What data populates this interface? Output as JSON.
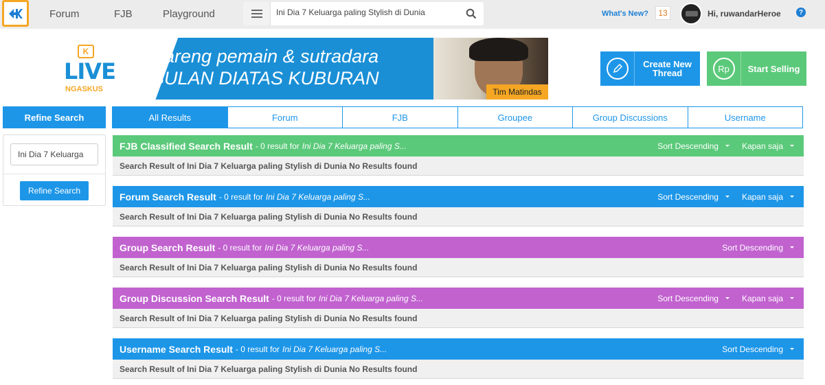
{
  "nav": {
    "links": [
      "Forum",
      "FJB",
      "Playground"
    ],
    "search_value": "Ini Dia 7 Keluarga paling Stylish di Dunia",
    "whats_new": "What's New?",
    "notification_count": "13",
    "greeting": "Hi, ruwandarHeroe",
    "help": "?"
  },
  "banner": {
    "live": "LIVE",
    "ngaskus": "NGASKUS",
    "logo_k": "K",
    "line1": "Bareng pemain & sutradara",
    "line2": "BULAN DIATAS KUBURAN",
    "person_name": "Tim Matindas"
  },
  "actions": {
    "create_thread": "Create New Thread",
    "start_selling": "Start Selling",
    "sell_icon": "Rp"
  },
  "sidebar": {
    "header": "Refine Search",
    "input_value": "Ini Dia 7 Keluarga",
    "button": "Refine Search"
  },
  "tabs": [
    "All Results",
    "Forum",
    "FJB",
    "Groupee",
    "Group Discussions",
    "Username"
  ],
  "sections": [
    {
      "title": "FJB Classified Search Result",
      "count": "- 0 result for",
      "query": "Ini Dia 7 Keluarga paling S...",
      "sort": "Sort Descending",
      "time": "Kapan saja",
      "body": "Search Result of Ini Dia 7 Keluarga paling Stylish di Dunia No Results found",
      "color": "#5bc97a"
    },
    {
      "title": "Forum Search Result",
      "count": "- 0 result for",
      "query": "Ini Dia 7 Keluarga paling S...",
      "sort": "Sort Descending",
      "time": "Kapan saja",
      "body": "Search Result of Ini Dia 7 Keluarga paling Stylish di Dunia No Results found",
      "color": "#1d96e8"
    },
    {
      "title": "Group Search Result",
      "count": "- 0 result for",
      "query": "Ini Dia 7 Keluarga paling S...",
      "sort": "Sort Descending",
      "body": "Search Result of Ini Dia 7 Keluarga paling Stylish di Dunia No Results found",
      "color": "#c162cf"
    },
    {
      "title": "Group Discussion Search Result",
      "count": "- 0 result for",
      "query": "Ini Dia 7 Keluarga paling S...",
      "sort": "Sort Descending",
      "time": "Kapan saja",
      "body": "Search Result of Ini Dia 7 Keluarga paling Stylish di Dunia No Results found",
      "color": "#c162cf"
    },
    {
      "title": "Username Search Result",
      "count": "- 0 result for",
      "query": "Ini Dia 7 Keluarga paling S...",
      "sort": "Sort Descending",
      "body": "Search Result of Ini Dia 7 Keluarga paling Stylish di Dunia No Results found",
      "color": "#1d96e8"
    }
  ]
}
